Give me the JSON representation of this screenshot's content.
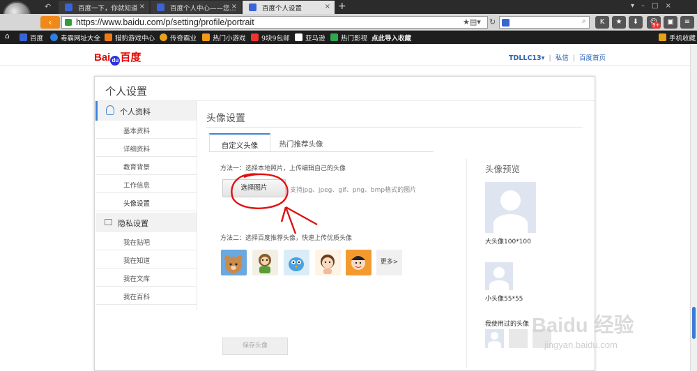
{
  "browser": {
    "tabs": [
      {
        "title": "百度一下，你就知道",
        "active": false
      },
      {
        "title": "百度个人中心——您...",
        "active": false
      },
      {
        "title": "百度个人设置",
        "active": true
      }
    ],
    "new_tab_glyph": "+",
    "close_glyph": "×",
    "url": "https://www.baidu.com/p/setting/profile/portrait",
    "badge": "9+"
  },
  "bookmarks": [
    {
      "label": "百度",
      "color": "#3a63d6"
    },
    {
      "label": "毒霸网址大全",
      "color": "#2f7fe0"
    },
    {
      "label": "猎豹游戏中心",
      "color": "#f07a14"
    },
    {
      "label": "传奇霸业",
      "color": "#e8a21a"
    },
    {
      "label": "热门小游戏",
      "color": "#f29b1a"
    },
    {
      "label": "9块9包邮",
      "color": "#e33"
    },
    {
      "label": "亚马逊",
      "color": "#fff"
    },
    {
      "label": "热门影视",
      "color": "#2fa84f"
    },
    {
      "label": "点此导入收藏",
      "color": ""
    }
  ],
  "mobile_bookmarks": "手机收藏",
  "header": {
    "logo_bai": "Bai",
    "logo_du": "du",
    "logo_cn": "百度",
    "user": "TDLLC13▾",
    "sep1": "|",
    "messages": "私信",
    "sep2": "|",
    "home": "百度首页"
  },
  "panel": {
    "title": "个人设置",
    "sidebar": {
      "profile_header": "个人资料",
      "profile_items": [
        "基本资料",
        "详细资料",
        "教育背景",
        "工作信息",
        "头像设置"
      ],
      "privacy_header": "隐私设置",
      "privacy_items": [
        "我在贴吧",
        "我在知道",
        "我在文库",
        "我在百科"
      ]
    },
    "content": {
      "title": "头像设置",
      "tabs": [
        "自定义头像",
        "热门推荐头像"
      ],
      "method1": "方法一：选择本地照片，上传编辑自己的头像",
      "choose_button": "选择图片",
      "support_text": "支持jpg、jpeg、gif、png、bmp格式的图片",
      "method2": "方法二：选择百度推荐头像，快速上传优质头像",
      "more_button": "更多>",
      "save_button": "保存头像"
    },
    "preview": {
      "title": "头像预览",
      "big_label": "大头像100*100",
      "small_label": "小头像55*55",
      "used_label": "我使用过的头像"
    }
  },
  "watermark": {
    "main": "Baidu 经验",
    "sub": "jingyan.baidu.com"
  },
  "colors": {
    "accent": "#3b83d9",
    "annotation": "#e01010"
  }
}
